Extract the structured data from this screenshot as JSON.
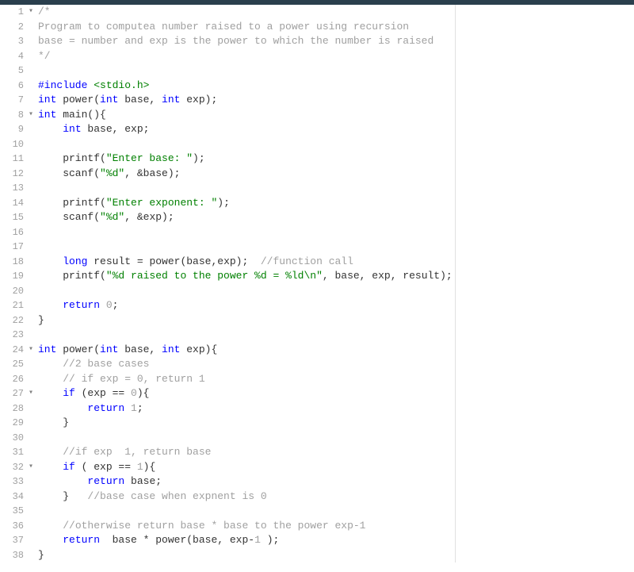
{
  "editor": {
    "lines": [
      {
        "num": 1,
        "fold": "▾",
        "tokens": [
          {
            "t": "/*",
            "c": "comment"
          }
        ]
      },
      {
        "num": 2,
        "fold": "",
        "tokens": [
          {
            "t": "Program to computea number raised to a power using recursion",
            "c": "comment"
          }
        ]
      },
      {
        "num": 3,
        "fold": "",
        "tokens": [
          {
            "t": "base = number and exp is the power to which the number is raised",
            "c": "comment"
          }
        ]
      },
      {
        "num": 4,
        "fold": "",
        "tokens": [
          {
            "t": "*/",
            "c": "comment"
          }
        ]
      },
      {
        "num": 5,
        "fold": "",
        "tokens": []
      },
      {
        "num": 6,
        "fold": "",
        "tokens": [
          {
            "t": "#include ",
            "c": "keyword-blue"
          },
          {
            "t": "<stdio.h>",
            "c": "include-brackets"
          }
        ]
      },
      {
        "num": 7,
        "fold": "",
        "tokens": [
          {
            "t": "int",
            "c": "keyword-blue"
          },
          {
            "t": " power(",
            "c": "plain"
          },
          {
            "t": "int",
            "c": "keyword-blue"
          },
          {
            "t": " base, ",
            "c": "plain"
          },
          {
            "t": "int",
            "c": "keyword-blue"
          },
          {
            "t": " exp);",
            "c": "plain"
          }
        ]
      },
      {
        "num": 8,
        "fold": "▾",
        "tokens": [
          {
            "t": "int",
            "c": "keyword-blue"
          },
          {
            "t": " main(){",
            "c": "plain"
          }
        ]
      },
      {
        "num": 9,
        "fold": "",
        "tokens": [
          {
            "t": "    ",
            "c": "plain"
          },
          {
            "t": "int",
            "c": "keyword-blue"
          },
          {
            "t": " base, exp;",
            "c": "plain"
          }
        ]
      },
      {
        "num": 10,
        "fold": "",
        "tokens": []
      },
      {
        "num": 11,
        "fold": "",
        "tokens": [
          {
            "t": "    printf(",
            "c": "plain"
          },
          {
            "t": "\"Enter base: \"",
            "c": "string"
          },
          {
            "t": ");",
            "c": "plain"
          }
        ]
      },
      {
        "num": 12,
        "fold": "",
        "tokens": [
          {
            "t": "    scanf(",
            "c": "plain"
          },
          {
            "t": "\"%d\"",
            "c": "string"
          },
          {
            "t": ", &base);",
            "c": "plain"
          }
        ]
      },
      {
        "num": 13,
        "fold": "",
        "tokens": []
      },
      {
        "num": 14,
        "fold": "",
        "tokens": [
          {
            "t": "    printf(",
            "c": "plain"
          },
          {
            "t": "\"Enter exponent: \"",
            "c": "string"
          },
          {
            "t": ");",
            "c": "plain"
          }
        ]
      },
      {
        "num": 15,
        "fold": "",
        "tokens": [
          {
            "t": "    scanf(",
            "c": "plain"
          },
          {
            "t": "\"%d\"",
            "c": "string"
          },
          {
            "t": ", &exp);",
            "c": "plain"
          }
        ]
      },
      {
        "num": 16,
        "fold": "",
        "tokens": []
      },
      {
        "num": 17,
        "fold": "",
        "tokens": []
      },
      {
        "num": 18,
        "fold": "",
        "tokens": [
          {
            "t": "    ",
            "c": "plain"
          },
          {
            "t": "long",
            "c": "keyword-blue"
          },
          {
            "t": " result = power(base,exp);  ",
            "c": "plain"
          },
          {
            "t": "//function call",
            "c": "comment"
          }
        ]
      },
      {
        "num": 19,
        "fold": "",
        "tokens": [
          {
            "t": "    printf(",
            "c": "plain"
          },
          {
            "t": "\"%d raised to the power %d = %ld\\n\"",
            "c": "string"
          },
          {
            "t": ", base, exp, result);",
            "c": "plain"
          }
        ]
      },
      {
        "num": 20,
        "fold": "",
        "tokens": []
      },
      {
        "num": 21,
        "fold": "",
        "tokens": [
          {
            "t": "    ",
            "c": "plain"
          },
          {
            "t": "return",
            "c": "keyword-blue"
          },
          {
            "t": " ",
            "c": "plain"
          },
          {
            "t": "0",
            "c": "number-lit"
          },
          {
            "t": ";",
            "c": "plain"
          }
        ]
      },
      {
        "num": 22,
        "fold": "",
        "tokens": [
          {
            "t": "}",
            "c": "plain"
          }
        ]
      },
      {
        "num": 23,
        "fold": "",
        "tokens": []
      },
      {
        "num": 24,
        "fold": "▾",
        "tokens": [
          {
            "t": "int",
            "c": "keyword-blue"
          },
          {
            "t": " power(",
            "c": "plain"
          },
          {
            "t": "int",
            "c": "keyword-blue"
          },
          {
            "t": " base, ",
            "c": "plain"
          },
          {
            "t": "int",
            "c": "keyword-blue"
          },
          {
            "t": " exp){",
            "c": "plain"
          }
        ]
      },
      {
        "num": 25,
        "fold": "",
        "tokens": [
          {
            "t": "    ",
            "c": "plain"
          },
          {
            "t": "//2 base cases",
            "c": "comment"
          }
        ]
      },
      {
        "num": 26,
        "fold": "",
        "tokens": [
          {
            "t": "    ",
            "c": "plain"
          },
          {
            "t": "// if exp = 0, return 1",
            "c": "comment"
          }
        ]
      },
      {
        "num": 27,
        "fold": "▾",
        "tokens": [
          {
            "t": "    ",
            "c": "plain"
          },
          {
            "t": "if",
            "c": "keyword-blue"
          },
          {
            "t": " (exp == ",
            "c": "plain"
          },
          {
            "t": "0",
            "c": "number-lit"
          },
          {
            "t": "){",
            "c": "plain"
          }
        ]
      },
      {
        "num": 28,
        "fold": "",
        "tokens": [
          {
            "t": "        ",
            "c": "plain"
          },
          {
            "t": "return",
            "c": "keyword-blue"
          },
          {
            "t": " ",
            "c": "plain"
          },
          {
            "t": "1",
            "c": "number-lit"
          },
          {
            "t": ";",
            "c": "plain"
          }
        ]
      },
      {
        "num": 29,
        "fold": "",
        "tokens": [
          {
            "t": "    }",
            "c": "plain"
          }
        ]
      },
      {
        "num": 30,
        "fold": "",
        "tokens": []
      },
      {
        "num": 31,
        "fold": "",
        "tokens": [
          {
            "t": "    ",
            "c": "plain"
          },
          {
            "t": "//if exp  1, return base",
            "c": "comment"
          }
        ]
      },
      {
        "num": 32,
        "fold": "▾",
        "tokens": [
          {
            "t": "    ",
            "c": "plain"
          },
          {
            "t": "if",
            "c": "keyword-blue"
          },
          {
            "t": " ( exp == ",
            "c": "plain"
          },
          {
            "t": "1",
            "c": "number-lit"
          },
          {
            "t": "){",
            "c": "plain"
          }
        ]
      },
      {
        "num": 33,
        "fold": "",
        "tokens": [
          {
            "t": "        ",
            "c": "plain"
          },
          {
            "t": "return",
            "c": "keyword-blue"
          },
          {
            "t": " base;",
            "c": "plain"
          }
        ]
      },
      {
        "num": 34,
        "fold": "",
        "tokens": [
          {
            "t": "    }   ",
            "c": "plain"
          },
          {
            "t": "//base case when expnent is 0",
            "c": "comment"
          }
        ]
      },
      {
        "num": 35,
        "fold": "",
        "tokens": []
      },
      {
        "num": 36,
        "fold": "",
        "tokens": [
          {
            "t": "    ",
            "c": "plain"
          },
          {
            "t": "//otherwise return base * base to the power exp-1",
            "c": "comment"
          }
        ]
      },
      {
        "num": 37,
        "fold": "",
        "tokens": [
          {
            "t": "    ",
            "c": "plain"
          },
          {
            "t": "return",
            "c": "keyword-blue"
          },
          {
            "t": "  base * power(base, exp-",
            "c": "plain"
          },
          {
            "t": "1",
            "c": "number-lit"
          },
          {
            "t": " );",
            "c": "plain"
          }
        ]
      },
      {
        "num": 38,
        "fold": "",
        "tokens": [
          {
            "t": "}",
            "c": "plain"
          }
        ]
      }
    ]
  }
}
